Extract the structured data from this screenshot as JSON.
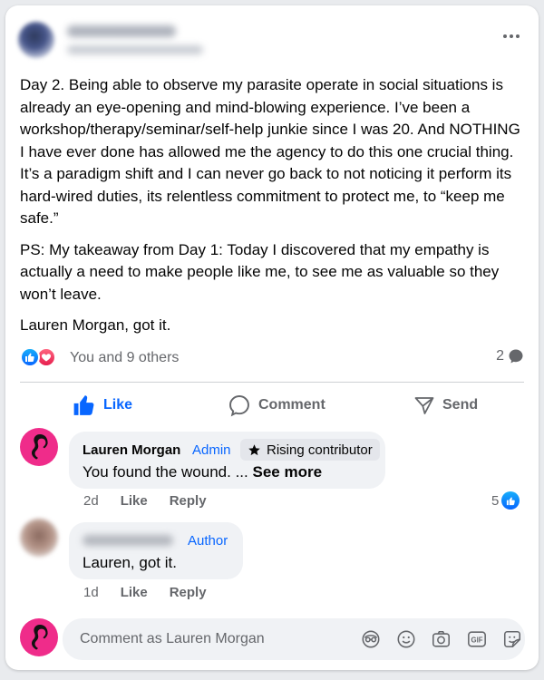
{
  "post": {
    "paragraphs": [
      "Day 2. Being able to observe my parasite operate in social situations is already an eye-opening and mind-blowing experience. I’ve been a workshop/therapy/seminar/self-help junkie since I was 20. And NOTHING I have ever done has allowed me the agency to do this one crucial thing. It’s a paradigm shift and I can never go back to not noticing it perform its hard-wired duties, its relentless commitment to protect me, to “keep me safe.”",
      "PS: My takeaway from Day 1: Today I discovered that my empathy is actually a need to make people like me, to see me as valuable so they won’t leave.",
      "Lauren Morgan, got it."
    ]
  },
  "reactions": {
    "text": "You and 9 others",
    "comment_count": "2"
  },
  "actions": {
    "like": "Like",
    "comment": "Comment",
    "send": "Send"
  },
  "comments": [
    {
      "name": "Lauren Morgan",
      "tag": "Admin",
      "badge": "Rising contributor",
      "text": "You found the wound. ...",
      "see_more": "See more",
      "time": "2d",
      "like": "Like",
      "reply": "Reply",
      "likes": "5"
    },
    {
      "tag": "Author",
      "text": "Lauren, got it.",
      "time": "1d",
      "like": "Like",
      "reply": "Reply"
    }
  ],
  "composer": {
    "placeholder": "Comment as Lauren Morgan"
  },
  "colors": {
    "accent": "#0866ff",
    "love": "#e61e4d",
    "avatar_pink": "#ef2c8a",
    "bubble": "#f0f2f5"
  },
  "icons": [
    "more-icon",
    "like-reaction-icon",
    "love-reaction-icon",
    "comment-bubble-icon",
    "thumbs-up-icon",
    "comment-icon",
    "send-icon",
    "star-icon",
    "avatar-icon",
    "sticker-icon",
    "emoji-icon",
    "camera-icon",
    "gif-icon",
    "emoji-sticker-icon"
  ]
}
